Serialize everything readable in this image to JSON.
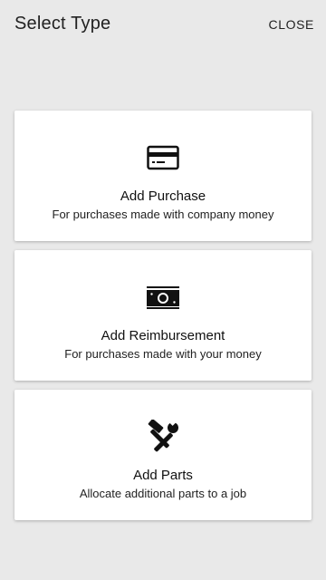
{
  "header": {
    "title": "Select Type",
    "close_label": "CLOSE"
  },
  "options": [
    {
      "title": "Add Purchase",
      "subtitle": "For purchases made with company money",
      "icon": "credit-card-icon"
    },
    {
      "title": "Add Reimbursement",
      "subtitle": "For purchases made with your money",
      "icon": "cash-icon"
    },
    {
      "title": "Add Parts",
      "subtitle": "Allocate additional parts to a job",
      "icon": "tools-icon"
    }
  ]
}
